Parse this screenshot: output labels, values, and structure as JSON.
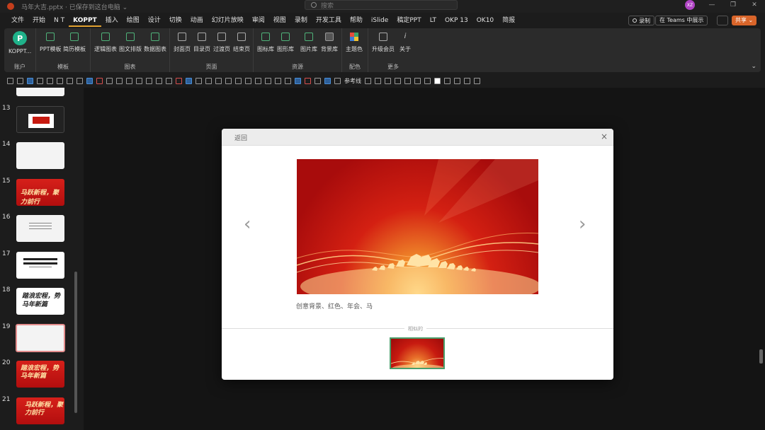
{
  "titlebar": {
    "doc_title": "马年大吉.pptx · 已保存到这台电脑 ⌄",
    "search_placeholder": "搜索",
    "avatar_initials": "XZ",
    "minimize": "—",
    "restore": "❐",
    "close": "✕"
  },
  "menu": {
    "tabs": [
      "文件",
      "开始",
      "N T",
      "KOPPT",
      "插入",
      "绘图",
      "设计",
      "切换",
      "动画",
      "幻灯片放映",
      "审阅",
      "视图",
      "录制",
      "开发工具",
      "帮助",
      "iSlide",
      "稿定PPT",
      "LT",
      "OKP 13",
      "OK10",
      "简报"
    ],
    "active_tab": "KOPPT",
    "record_label": "录制",
    "teams_label": "在 Teams 中展示",
    "share_label": "共享 ⌄"
  },
  "ribbon": {
    "groups": [
      {
        "label": "账户",
        "buttons": [
          "KOPPT..."
        ]
      },
      {
        "label": "模板",
        "buttons": [
          "PPT模板",
          "简历模板"
        ]
      },
      {
        "label": "图表",
        "buttons": [
          "逻辑图表",
          "图文排版",
          "数据图表"
        ]
      },
      {
        "label": "页面",
        "buttons": [
          "封面页",
          "目录页",
          "过渡页",
          "结束页"
        ]
      },
      {
        "label": "资源",
        "buttons": [
          "图标库",
          "图形库",
          "图片库",
          "背景库"
        ]
      },
      {
        "label": "配色",
        "buttons": [
          "主题色"
        ]
      },
      {
        "label": "更多",
        "buttons": [
          "升级会员",
          "关于"
        ]
      }
    ],
    "collapse_icon": "⌄"
  },
  "quickbar": {
    "ref_line_label": "参考线"
  },
  "slides": {
    "numbers": [
      "13",
      "14",
      "15",
      "16",
      "17",
      "18",
      "19",
      "20",
      "21"
    ],
    "thumb_text_15": "马跃新程，聚力前行",
    "thumb_text_18": "踏浪宏程，势马年新篇",
    "thumb_text_20": "踏浪宏程，势马年新篇",
    "thumb_text_21": "马跃新程，聚力前行",
    "selected": "19"
  },
  "modal": {
    "back_label": "返回",
    "close_label": "×",
    "prev_arrow": "‹",
    "next_arrow": "›",
    "caption": "创意背景、红色、年会、马",
    "similar_label": "相似的"
  },
  "colors": {
    "accent": "#d9652a",
    "koppt_green": "#1fb28a",
    "brand_red": "#c43e1c"
  }
}
